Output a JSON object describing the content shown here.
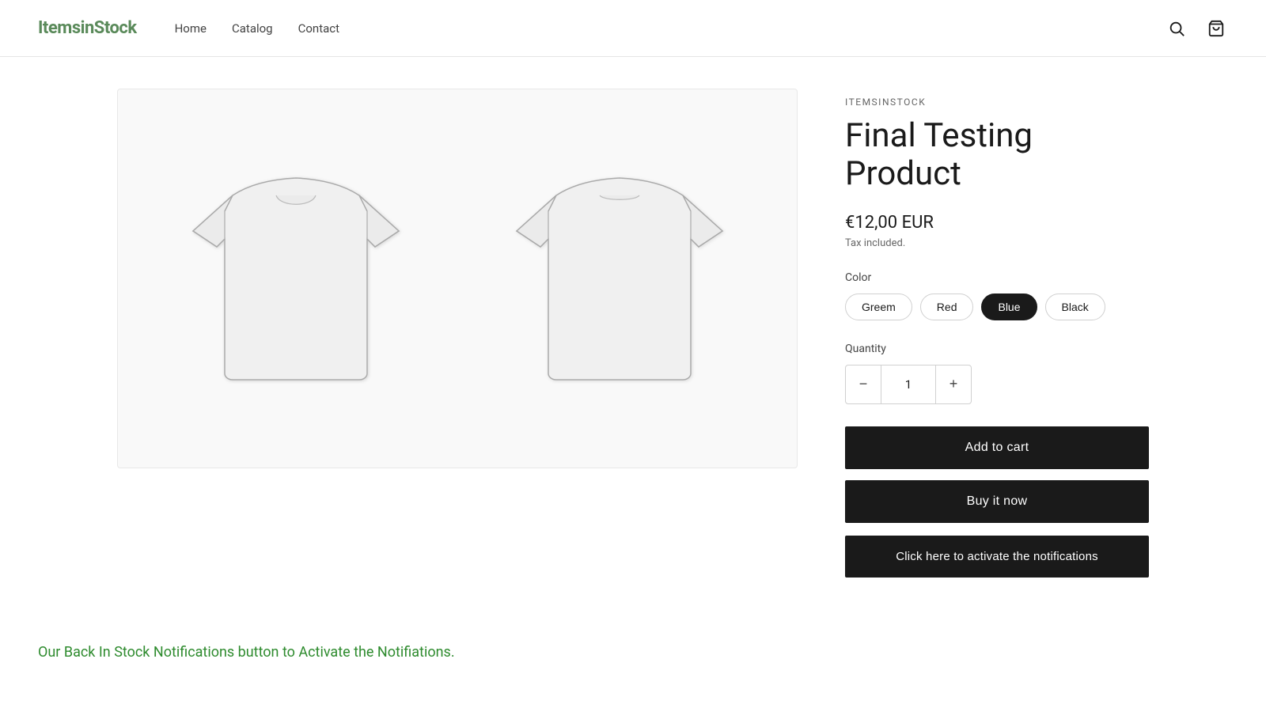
{
  "header": {
    "logo_text": "ItemsinStock",
    "nav": [
      {
        "label": "Home",
        "href": "#"
      },
      {
        "label": "Catalog",
        "href": "#"
      },
      {
        "label": "Contact",
        "href": "#"
      }
    ]
  },
  "product": {
    "vendor": "ITEMSINSTOCK",
    "title": "Final Testing Product",
    "price": "€12,00 EUR",
    "tax_note": "Tax included.",
    "color_label": "Color",
    "colors": [
      "Greem",
      "Red",
      "Blue",
      "Black"
    ],
    "active_color": "Blue",
    "quantity_label": "Quantity",
    "quantity_value": 1,
    "btn_add_cart": "Add to cart",
    "btn_buy_now": "Buy it now",
    "btn_notify": "Click here to activate the notifications"
  },
  "bottom_banner": {
    "text": "Our Back In Stock Notifications button to Activate the Notifiations."
  }
}
